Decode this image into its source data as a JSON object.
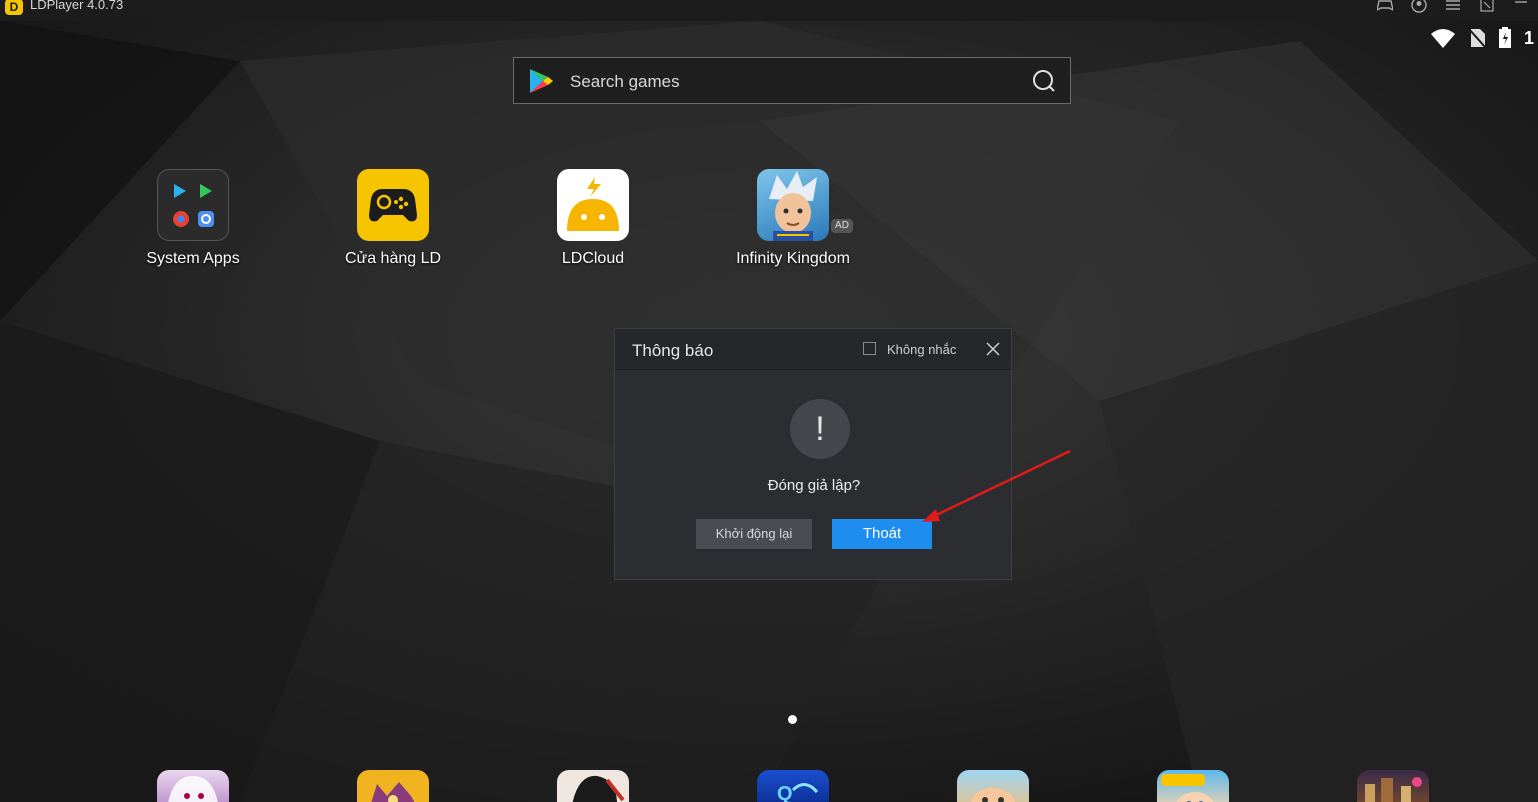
{
  "window": {
    "title": "LDPlayer 4.0.73",
    "logo_letter": "D",
    "controls": [
      "gamepad-icon",
      "account-icon",
      "menu-icon",
      "minimize-to-tray-icon",
      "minimize-icon"
    ]
  },
  "status_bar": {
    "clock": "1",
    "icons": [
      "wifi-icon",
      "no-sim-icon",
      "battery-charging-icon"
    ]
  },
  "search": {
    "placeholder": "Search games"
  },
  "apps": [
    {
      "name": "System Apps",
      "icon": "system-apps-folder-icon"
    },
    {
      "name": "Cửa hàng LD",
      "icon": "ld-store-gamepad-icon"
    },
    {
      "name": "LDCloud",
      "icon": "ldcloud-icon"
    },
    {
      "name": "Infinity Kingdom",
      "icon": "infinity-kingdom-icon",
      "badge": "AD"
    }
  ],
  "dialog": {
    "title": "Thông báo",
    "dont_remind_label": "Không nhắc",
    "dont_remind_checked": false,
    "alert_symbol": "!",
    "message": "Đóng giả lập?",
    "restart_label": "Khởi động lại",
    "exit_label": "Thoát"
  },
  "pager": {
    "current_page": 1
  },
  "dock": [
    {
      "icon": "anime-girl-game-icon"
    },
    {
      "icon": "monster-game-icon"
    },
    {
      "icon": "martial-arts-game-icon"
    },
    {
      "icon": "quan-game-icon"
    },
    {
      "icon": "cartoon-animal-game-icon"
    },
    {
      "icon": "genuine-game-icon"
    },
    {
      "icon": "strategy-game-icon"
    }
  ],
  "colors": {
    "accent": "#1e8df0",
    "ld_yellow": "#f7c500",
    "annotation_arrow": "#e01b1b"
  }
}
